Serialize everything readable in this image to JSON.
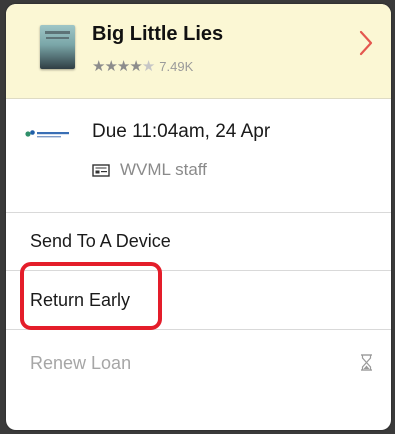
{
  "book": {
    "title": "Big Little Lies",
    "stars": [
      "★",
      "★",
      "★",
      "★",
      "★"
    ],
    "rating_value": 4.5,
    "rating_count": "7.49K"
  },
  "loan": {
    "due": "Due 11:04am, 24 Apr",
    "card": "WVML staff",
    "library_logo": "library-logo"
  },
  "menu": {
    "send_label": "Send To A Device",
    "return_label": "Return Early",
    "renew_label": "Renew Loan"
  },
  "icons": {
    "chevron": "chevron-right-icon",
    "card": "library-card-icon",
    "hourglass": "hourglass-icon"
  },
  "colors": {
    "header_bg": "#fbf7d4",
    "accent": "#e4574f",
    "highlight": "#e41d2a"
  }
}
